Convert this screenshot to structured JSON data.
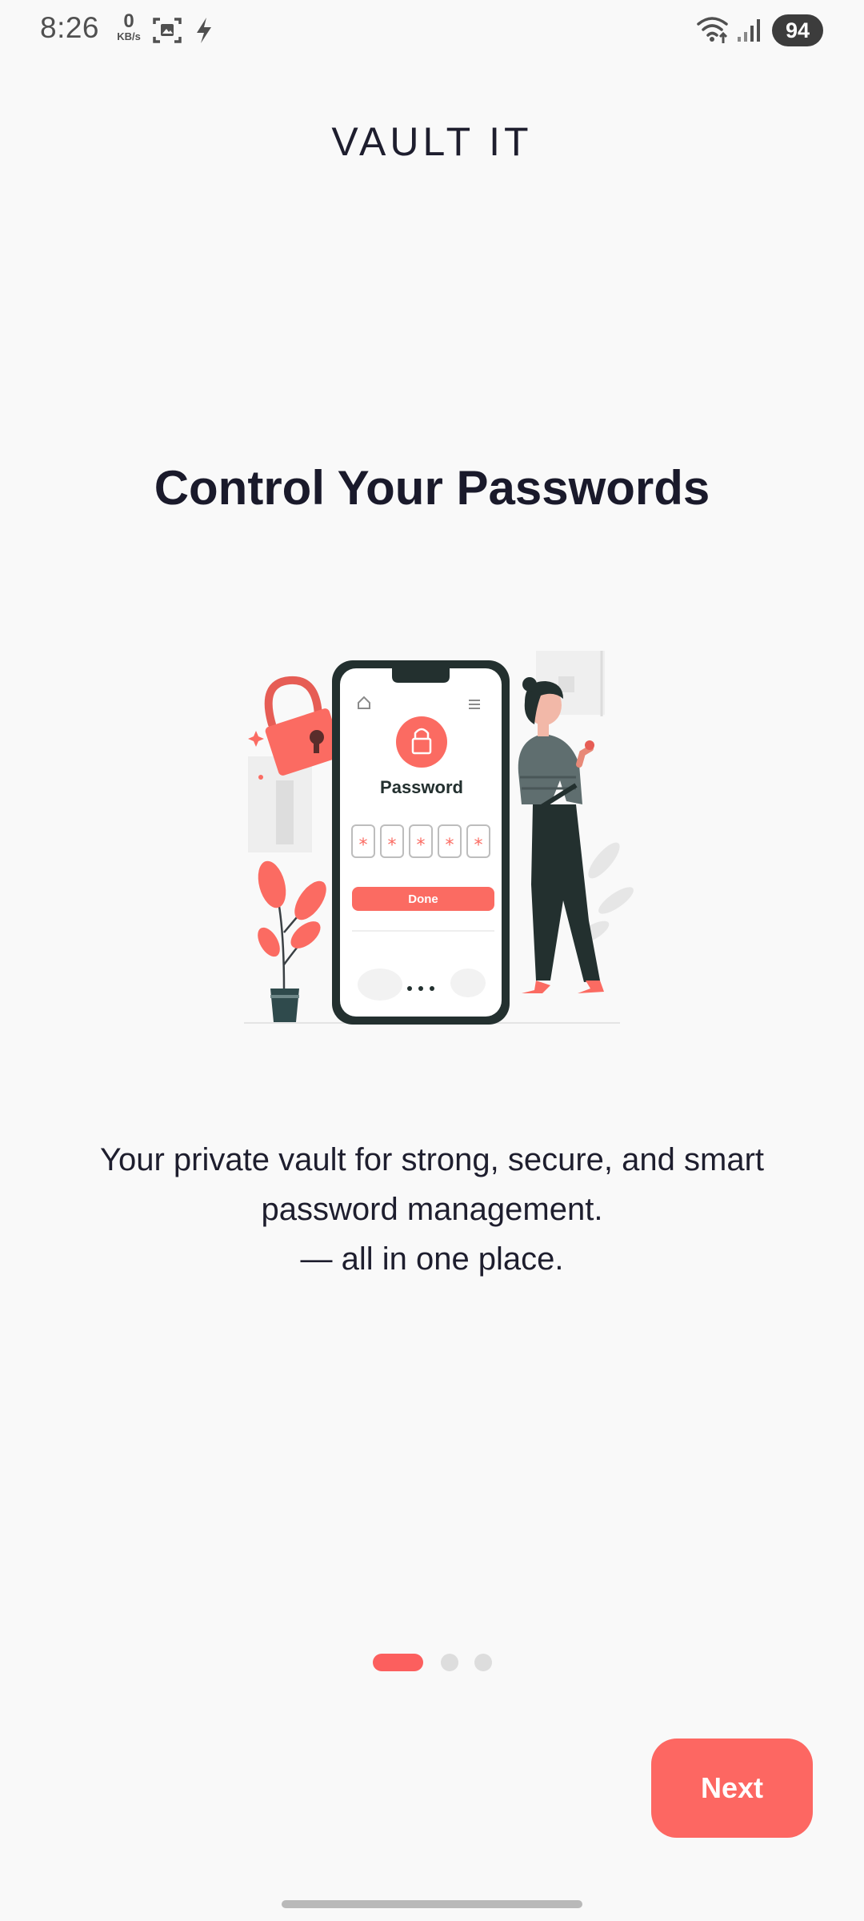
{
  "status_bar": {
    "time": "8:26",
    "net_speed_value": "0",
    "net_speed_unit": "KB/s",
    "battery": "94",
    "icons": [
      "screenshot-icon",
      "flash-icon",
      "wifi-icon",
      "signal-icon"
    ]
  },
  "app": {
    "title": "VAULT IT"
  },
  "slide": {
    "title": "Control Your Passwords",
    "illustration_texts": {
      "field_label": "Password",
      "button_label": "Done",
      "mask_char": "*"
    },
    "description_lines": [
      "Your private vault for strong, secure, and smart",
      "password management.",
      "— all in one place."
    ]
  },
  "pagination": {
    "total": 3,
    "active_index": 0
  },
  "actions": {
    "next_label": "Next"
  },
  "colors": {
    "accent": "#fd6762",
    "background": "#f9f9f9",
    "text": "#1a1a2b",
    "dot_inactive": "#dddddd"
  }
}
